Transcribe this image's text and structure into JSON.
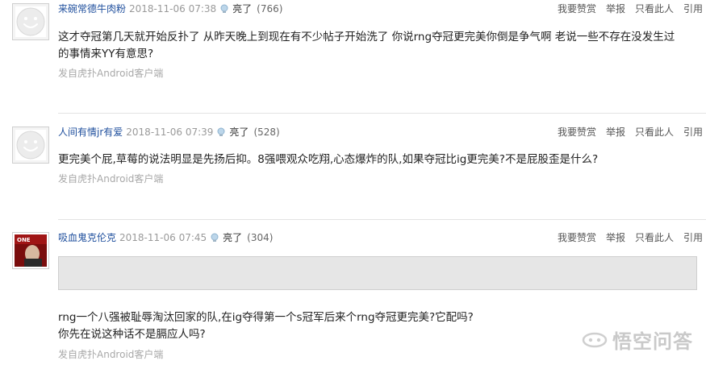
{
  "posts": [
    {
      "username": "来碗常德牛肉粉",
      "date": "2018-11-06 07:38",
      "reaction_label": "亮了",
      "reaction_count": "(766)",
      "actions": [
        "我要赞赏",
        "举报",
        "只看此人",
        "引用"
      ],
      "body_lines": [
        "这才夺冠第几天就开始反扑了 从昨天晚上到现在有不少帖子开始洗了 你说rng夺冠更完美你倒是争气啊 老说一些不存在没发生过",
        "的事情来YY有意思?"
      ],
      "source": "发自虎扑Android客户端"
    },
    {
      "username": "人间有情jr有爱",
      "date": "2018-11-06 07:39",
      "reaction_label": "亮了",
      "reaction_count": "(528)",
      "actions": [
        "我要赞赏",
        "举报",
        "只看此人",
        "引用"
      ],
      "body_lines": [
        "更完美个屁,草莓的说法明显是先扬后抑。8强喂观众吃翔,心态爆炸的队,如果夺冠比ig更完美?不是屁股歪是什么?"
      ],
      "source": "发自虎扑Android客户端"
    },
    {
      "username": "吸血鬼克伦克",
      "date": "2018-11-06 07:45",
      "reaction_label": "亮了",
      "reaction_count": "(304)",
      "actions": [
        "我要赞赏",
        "举报",
        "只看此人",
        "引用"
      ],
      "avatar_text": "ONE",
      "body_lines": [
        "rng一个八强被耻辱淘汰回家的队,在ig夺得第一个s冠军后来个rng夺冠更完美?它配吗?",
        "你先在说这种话不是膈应人吗?"
      ],
      "source": "发自虎扑Android客户端"
    }
  ],
  "watermark": {
    "text": "悟空问答"
  },
  "colors": {
    "username": "#1f4f9d",
    "meta": "#9a9a9a",
    "hidden_box": "#e6e6e6"
  }
}
